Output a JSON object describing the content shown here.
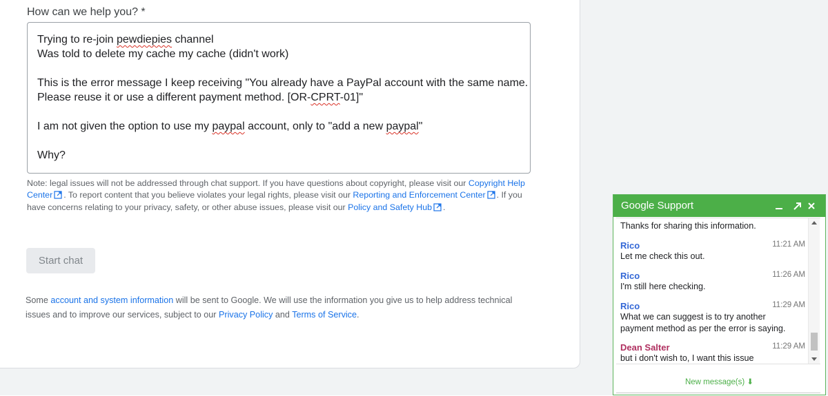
{
  "form": {
    "label": "How can we help you? *",
    "message_lines": [
      {
        "segments": [
          {
            "text": "Trying to re-join "
          },
          {
            "text": "pewdiepies",
            "spell": true
          },
          {
            "text": " channel"
          }
        ]
      },
      {
        "segments": [
          {
            "text": "Was told to delete my cache my cache (didn't work)"
          }
        ]
      },
      {
        "segments": []
      },
      {
        "segments": [
          {
            "text": "This is the error message I keep receiving \"You already have a PayPal account with the same name."
          }
        ]
      },
      {
        "segments": [
          {
            "text": "Please reuse it or use a different payment method. [OR-"
          },
          {
            "text": "CPRT",
            "spell": true
          },
          {
            "text": "-01]\""
          }
        ]
      },
      {
        "segments": []
      },
      {
        "segments": [
          {
            "text": "I am not given the option to use my "
          },
          {
            "text": "paypal",
            "spell": true
          },
          {
            "text": " account, only to \"add a new "
          },
          {
            "text": "paypal",
            "spell": true
          },
          {
            "text": "\""
          }
        ]
      },
      {
        "segments": []
      },
      {
        "segments": [
          {
            "text": "Why?"
          }
        ]
      }
    ]
  },
  "note": {
    "t1": "Note: legal issues will not be addressed through chat support. If you have questions about copyright, please visit our ",
    "link1": "Copyright Help Center",
    "t2": ". To report content that you believe violates your legal rights, please visit our ",
    "link2": "Reporting and Enforcement Center",
    "t3": ". If you have concerns relating to your privacy, safety, or other abuse issues, please visit our ",
    "link3": "Policy and Safety Hub",
    "t4": "."
  },
  "start_chat_label": "Start chat",
  "info": {
    "t1": "Some ",
    "link1": "account and system information",
    "t2": " will be sent to Google. We will use the information you give us to help address technical issues and to improve our services, subject to our ",
    "link2": "Privacy Policy",
    "t3": " and ",
    "link3": "Terms of Service",
    "t4": "."
  },
  "chat": {
    "title": "Google Support",
    "intro": "Thanks for sharing this information.",
    "messages": [
      {
        "sender": "Rico",
        "time": "11:21 AM",
        "text": "Let me check this out.",
        "agent": true
      },
      {
        "sender": "Rico",
        "time": "11:26 AM",
        "text": "I'm still here checking.",
        "agent": true
      },
      {
        "sender": "Rico",
        "time": "11:29 AM",
        "text": "What we can suggest is to try another payment method as per the error is saying.",
        "agent": true
      },
      {
        "sender": "Dean Salter",
        "time": "11:29 AM",
        "text": "but i don't wish to, I want this issue resolved...",
        "agent": false
      }
    ],
    "new_messages": "New message(s) ⬇",
    "colors": {
      "header": "#4caf48",
      "agent": "#3367d6",
      "user": "#b03060"
    }
  },
  "icons": {
    "external": "external-link-icon",
    "minimize": "minimize-icon",
    "popout": "popout-icon",
    "close": "close-icon"
  }
}
